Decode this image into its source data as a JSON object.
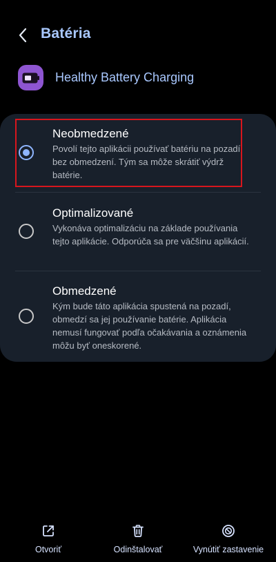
{
  "header": {
    "title": "Batéria",
    "back_icon": "chevron-left-icon"
  },
  "app": {
    "name": "Healthy Battery Charging",
    "icon": "battery-app-icon",
    "icon_color": "#8e55d1"
  },
  "options": [
    {
      "title": "Neobmedzené",
      "description": "Povolí tejto aplikácii používať batériu na pozadí bez obmedzení. Tým sa môže skrátiť výdrž batérie.",
      "selected": true
    },
    {
      "title": "Optimalizované",
      "description": "Vykonáva optimalizáciu na základe používania tejto aplikácie. Odporúča sa pre väčšinu aplikácií.",
      "selected": false
    },
    {
      "title": "Obmedzené",
      "description": "Kým bude táto aplikácia spustená na pozadí, obmedzí sa jej používanie batérie. Aplikácia nemusí fungovať podľa očakávania a oznámenia môžu byť oneskorené.",
      "selected": false
    }
  ],
  "bottom_actions": [
    {
      "label": "Otvoriť",
      "icon": "open-external-icon"
    },
    {
      "label": "Odinštalovať",
      "icon": "trash-icon"
    },
    {
      "label": "Vynútiť zastavenie",
      "icon": "block-icon"
    }
  ],
  "colors": {
    "accent": "#a9c8ff",
    "radio_selected": "#8fb6ff",
    "card_bg": "#18202b",
    "highlight_border": "#d8161d",
    "background": "#000000"
  }
}
